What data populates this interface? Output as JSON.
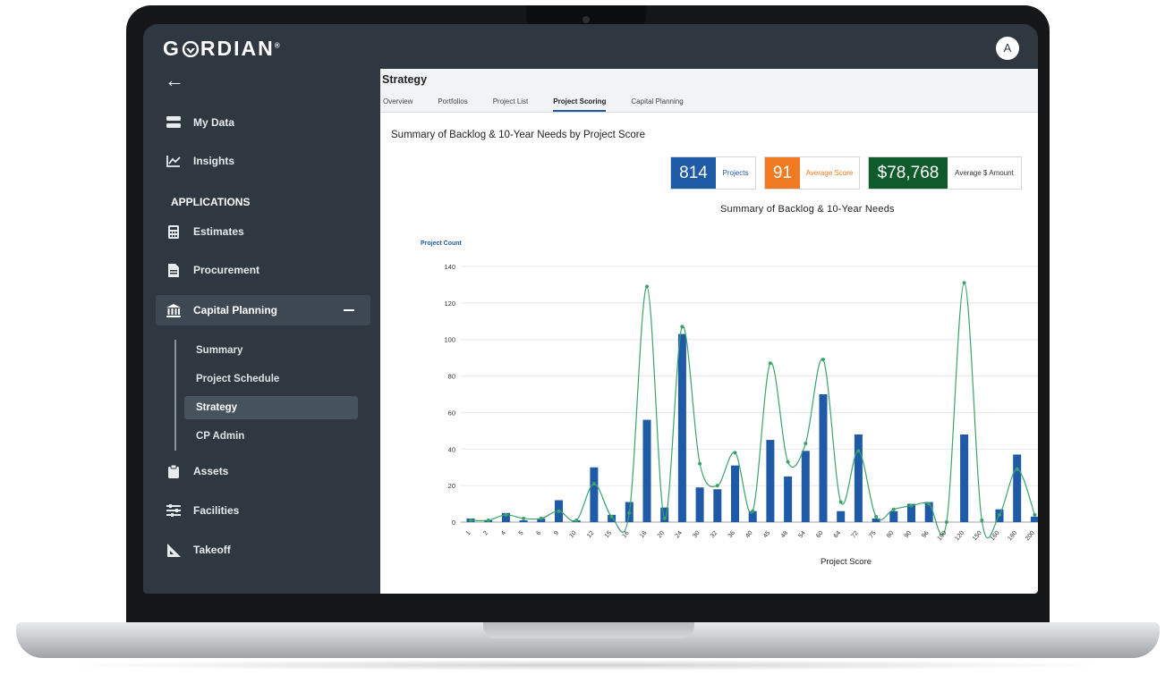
{
  "app": {
    "logo_text": "G",
    "logo_text_rest": "RDIAN",
    "logo_mark": "®",
    "avatar_initial": "A"
  },
  "sidebar": {
    "back_icon": "arrow-left-icon",
    "items": [
      {
        "label": "My Data",
        "icon": "database-icon"
      },
      {
        "label": "Insights",
        "icon": "line-chart-icon"
      }
    ],
    "section_label": "APPLICATIONS",
    "apps": [
      {
        "label": "Estimates",
        "icon": "calculator-icon"
      },
      {
        "label": "Procurement",
        "icon": "document-icon"
      },
      {
        "label": "Capital Planning",
        "icon": "bank-icon",
        "expanded": true
      },
      {
        "label": "Assets",
        "icon": "clipboard-icon"
      },
      {
        "label": "Facilities",
        "icon": "sliders-icon"
      },
      {
        "label": "Takeoff",
        "icon": "ruler-triangle-icon"
      }
    ],
    "subitems": [
      {
        "label": "Summary"
      },
      {
        "label": "Project Schedule"
      },
      {
        "label": "Strategy",
        "active": true
      },
      {
        "label": "CP Admin"
      }
    ]
  },
  "main": {
    "title": "Strategy",
    "tabs": [
      "Overview",
      "Portfolios",
      "Project List",
      "Project Scoring",
      "Capital Planning"
    ],
    "active_tab": "Project Scoring",
    "section_title": "Summary of Backlog & 10-Year Needs by Project Score",
    "kpis": [
      {
        "value": "814",
        "label": "Projects",
        "color": "#1f5aa6",
        "label_color": "#1f5aa6"
      },
      {
        "value": "91",
        "label": "Average Score",
        "color": "#ef7a21",
        "label_color": "#ef7a21"
      },
      {
        "value": "$78,768",
        "label": "Average $ Amount",
        "color": "#0f5b2c",
        "label_color": "#333333"
      }
    ]
  },
  "chart_data": {
    "type": "bar",
    "title": "Summary of Backlog & 10-Year Needs",
    "xlabel": "Project Score",
    "ylabel": "Project Count",
    "ylim": [
      0,
      140
    ],
    "yticks": [
      0,
      20,
      40,
      60,
      80,
      100,
      120,
      140
    ],
    "grid": true,
    "categories": [
      "1",
      "2",
      "4",
      "5",
      "6",
      "9",
      "10",
      "12",
      "15",
      "16",
      "18",
      "20",
      "24",
      "30",
      "32",
      "36",
      "40",
      "45",
      "48",
      "54",
      "60",
      "64",
      "72",
      "75",
      "80",
      "90",
      "96",
      "100",
      "120",
      "150",
      "160",
      "180",
      "200"
    ],
    "series": [
      {
        "type": "bar",
        "color": "#1f5aa6",
        "values": [
          2,
          1,
          5,
          1,
          2,
          12,
          1,
          30,
          4,
          11,
          56,
          8,
          103,
          19,
          18,
          31,
          6,
          45,
          25,
          39,
          70,
          6,
          48,
          2,
          6,
          10,
          11,
          0,
          48,
          0,
          7,
          37,
          3
        ]
      },
      {
        "type": "line",
        "color": "#3aa36a",
        "values": [
          1,
          1,
          4,
          2,
          2,
          6,
          1,
          21,
          3,
          5,
          129,
          2,
          107,
          32,
          20,
          38,
          6,
          87,
          33,
          43,
          89,
          11,
          39,
          3,
          7,
          9,
          10,
          0,
          131,
          1,
          4,
          29,
          4
        ]
      }
    ]
  }
}
